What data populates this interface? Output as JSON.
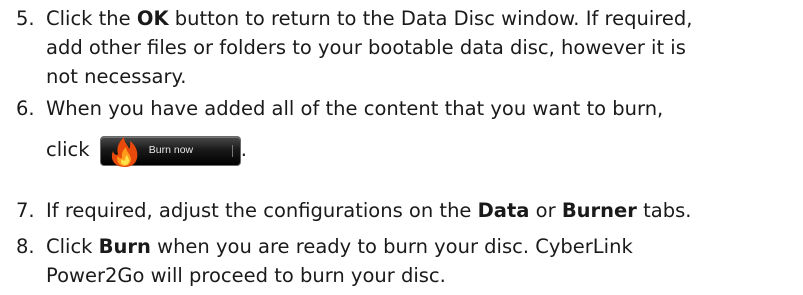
{
  "steps": [
    {
      "number": "5.",
      "parts": [
        "Click the ",
        "OK",
        " button to return to the Data Disc window. If required,",
        "add other files or folders to your bootable data disc, however it is",
        "not necessary."
      ]
    },
    {
      "number": "6.",
      "line1": "When you have added all of the content that you want to burn,",
      "line2_prefix": "click",
      "line2_suffix": "."
    },
    {
      "number": "7.",
      "parts": [
        "If required, adjust the configurations on the ",
        "Data",
        " or ",
        "Burner",
        " tabs."
      ]
    },
    {
      "number": "8.",
      "parts": [
        "Click ",
        "Burn",
        " when you are ready to burn your disc. CyberLink",
        "Power2Go will proceed to burn your disc."
      ]
    }
  ],
  "burn_button": {
    "label": "Burn now",
    "icon": "flame-icon"
  }
}
